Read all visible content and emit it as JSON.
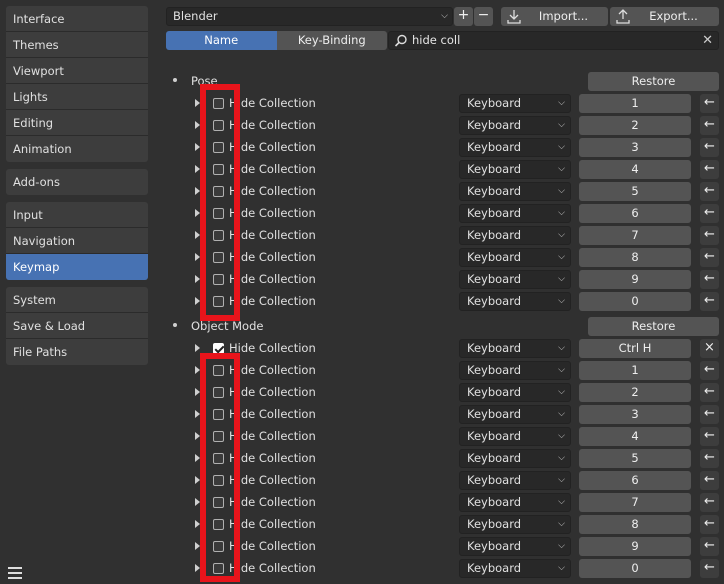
{
  "sidebar": {
    "groups": [
      {
        "items": [
          {
            "label": "Interface"
          },
          {
            "label": "Themes"
          },
          {
            "label": "Viewport"
          },
          {
            "label": "Lights"
          },
          {
            "label": "Editing"
          },
          {
            "label": "Animation"
          }
        ]
      },
      {
        "items": [
          {
            "label": "Add-ons"
          }
        ]
      },
      {
        "items": [
          {
            "label": "Input"
          },
          {
            "label": "Navigation"
          },
          {
            "label": "Keymap",
            "active": true
          }
        ]
      },
      {
        "items": [
          {
            "label": "System"
          },
          {
            "label": "Save & Load"
          },
          {
            "label": "File Paths"
          }
        ]
      }
    ]
  },
  "topbar": {
    "preset": "Blender",
    "plus_label": "+",
    "minus_label": "−",
    "import_label": "Import...",
    "export_label": "Export..."
  },
  "filter": {
    "tab_name": "Name",
    "tab_key_binding": "Key-Binding",
    "search_value": "hide coll"
  },
  "sections": [
    {
      "name": "Pose",
      "restore_label": "Restore",
      "rows": [
        {
          "name": "Hide Collection",
          "checked": false,
          "device": "Keyboard",
          "key": "1",
          "action": "←"
        },
        {
          "name": "Hide Collection",
          "checked": false,
          "device": "Keyboard",
          "key": "2",
          "action": "←"
        },
        {
          "name": "Hide Collection",
          "checked": false,
          "device": "Keyboard",
          "key": "3",
          "action": "←"
        },
        {
          "name": "Hide Collection",
          "checked": false,
          "device": "Keyboard",
          "key": "4",
          "action": "←"
        },
        {
          "name": "Hide Collection",
          "checked": false,
          "device": "Keyboard",
          "key": "5",
          "action": "←"
        },
        {
          "name": "Hide Collection",
          "checked": false,
          "device": "Keyboard",
          "key": "6",
          "action": "←"
        },
        {
          "name": "Hide Collection",
          "checked": false,
          "device": "Keyboard",
          "key": "7",
          "action": "←"
        },
        {
          "name": "Hide Collection",
          "checked": false,
          "device": "Keyboard",
          "key": "8",
          "action": "←"
        },
        {
          "name": "Hide Collection",
          "checked": false,
          "device": "Keyboard",
          "key": "9",
          "action": "←"
        },
        {
          "name": "Hide Collection",
          "checked": false,
          "device": "Keyboard",
          "key": "0",
          "action": "←"
        }
      ]
    },
    {
      "name": "Object Mode",
      "restore_label": "Restore",
      "rows": [
        {
          "name": "Hide Collection",
          "checked": true,
          "device": "Keyboard",
          "key": "Ctrl H",
          "action": "×"
        },
        {
          "name": "Hide Collection",
          "checked": false,
          "device": "Keyboard",
          "key": "1",
          "action": "←"
        },
        {
          "name": "Hide Collection",
          "checked": false,
          "device": "Keyboard",
          "key": "2",
          "action": "←"
        },
        {
          "name": "Hide Collection",
          "checked": false,
          "device": "Keyboard",
          "key": "3",
          "action": "←"
        },
        {
          "name": "Hide Collection",
          "checked": false,
          "device": "Keyboard",
          "key": "4",
          "action": "←"
        },
        {
          "name": "Hide Collection",
          "checked": false,
          "device": "Keyboard",
          "key": "5",
          "action": "←"
        },
        {
          "name": "Hide Collection",
          "checked": false,
          "device": "Keyboard",
          "key": "6",
          "action": "←"
        },
        {
          "name": "Hide Collection",
          "checked": false,
          "device": "Keyboard",
          "key": "7",
          "action": "←"
        },
        {
          "name": "Hide Collection",
          "checked": false,
          "device": "Keyboard",
          "key": "8",
          "action": "←"
        },
        {
          "name": "Hide Collection",
          "checked": false,
          "device": "Keyboard",
          "key": "9",
          "action": "←"
        },
        {
          "name": "Hide Collection",
          "checked": false,
          "device": "Keyboard",
          "key": "0",
          "action": "←"
        }
      ]
    }
  ],
  "highlight_color": "#e8141b",
  "accent_color": "#4772b3"
}
